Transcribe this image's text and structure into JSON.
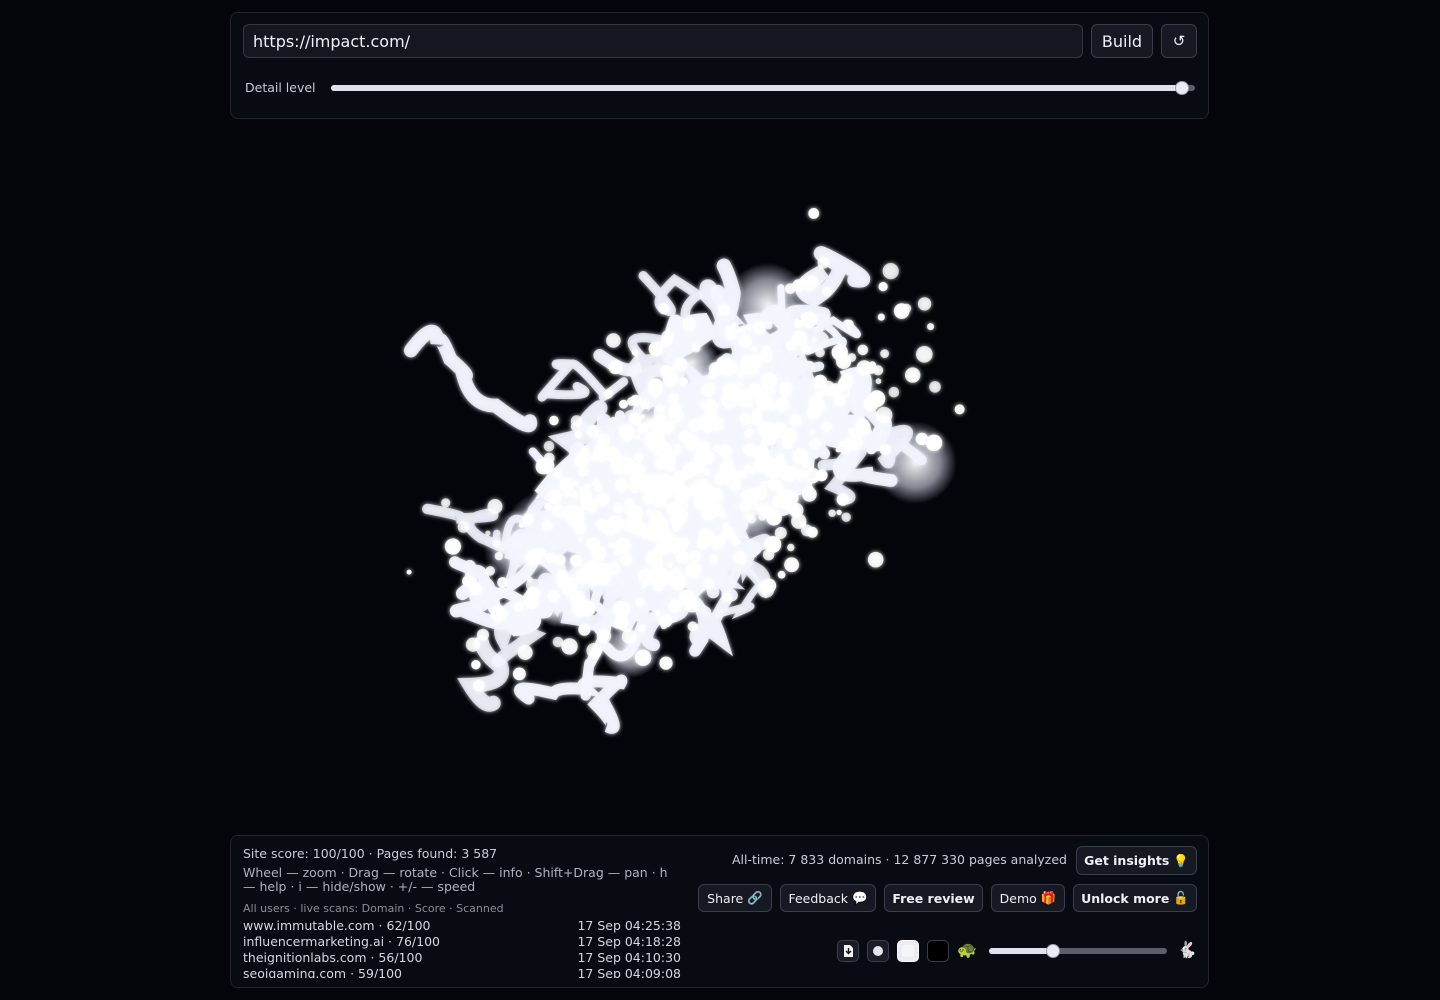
{
  "address": {
    "url": "https://impact.com/",
    "build_label": "Build",
    "reset_icon": "↺"
  },
  "detail": {
    "label": "Detail level",
    "level": 0.985
  },
  "stats": {
    "summary": "Site score: 100/100 · Pages found: 3 587",
    "hint": "Wheel — zoom · Drag — rotate · Click — info · Shift+Drag — pan · h — help · i — hide/show · +/- — speed",
    "alltime": "All-time: 7 833 domains · 12 877 330 pages analyzed"
  },
  "scans": {
    "header": "All users · live scans: Domain · Score · Scanned",
    "rows": [
      {
        "domain": "www.immutable.com · 62/100",
        "time": "17 Sep 04:25:38"
      },
      {
        "domain": "influencermarketing.ai · 76/100",
        "time": "17 Sep 04:18:28"
      },
      {
        "domain": "theignitionlabs.com · 56/100",
        "time": "17 Sep 04:10:30"
      },
      {
        "domain": "seoigaming.com · 59/100",
        "time": "17 Sep 04:09:08"
      }
    ]
  },
  "buttons": {
    "insights": "Get insights",
    "insights_icon": "💡",
    "share": "Share",
    "share_icon": "🔗",
    "feedback": "Feedback",
    "feedback_icon": "💬",
    "review": "Free review",
    "demo": "Demo",
    "demo_icon": "🎁",
    "unlock": "Unlock more",
    "unlock_icon": "🔓"
  },
  "toolbar": {
    "download_icon": "download-icon",
    "slow_icon": "🐢",
    "fast_icon": "🐇",
    "speed": 0.36
  },
  "colors": {
    "background": "#04050a",
    "panel": "#0a0c14",
    "glow": "#ffffff"
  }
}
